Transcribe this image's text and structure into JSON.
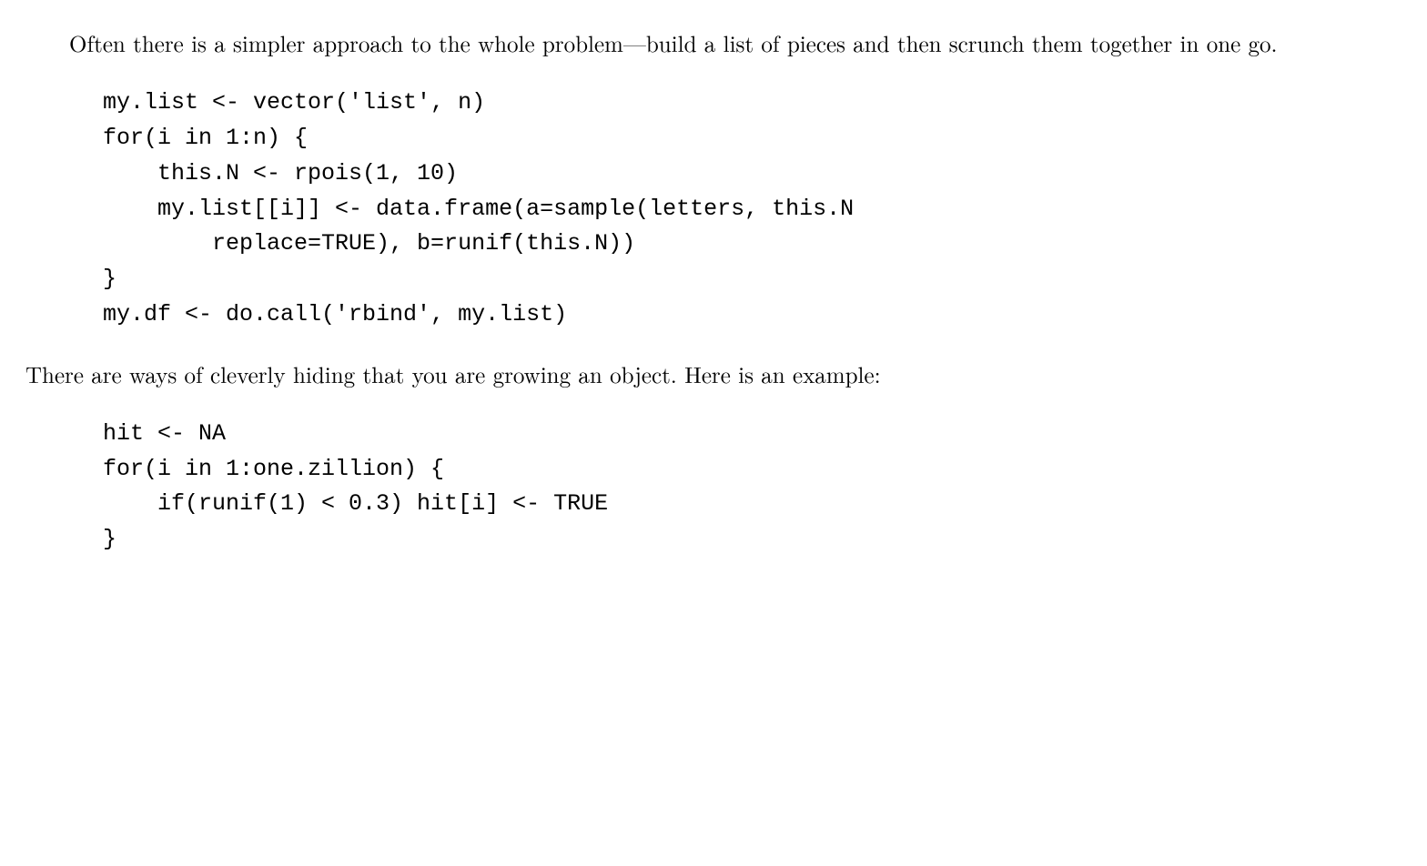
{
  "paragraph1": "Often there is a simpler approach to the whole problem—build a list of pieces and then scrunch them together in one go.",
  "code1": "my.list <- vector('list', n)\nfor(i in 1:n) {\n    this.N <- rpois(1, 10)\n    my.list[[i]] <- data.frame(a=sample(letters, this.N\n        replace=TRUE), b=runif(this.N))\n}\nmy.df <- do.call('rbind', my.list)",
  "paragraph2": "There are ways of cleverly hiding that you are growing an object.  Here is an example:",
  "code2": "hit <- NA\nfor(i in 1:one.zillion) {\n    if(runif(1) < 0.3) hit[i] <- TRUE\n}"
}
